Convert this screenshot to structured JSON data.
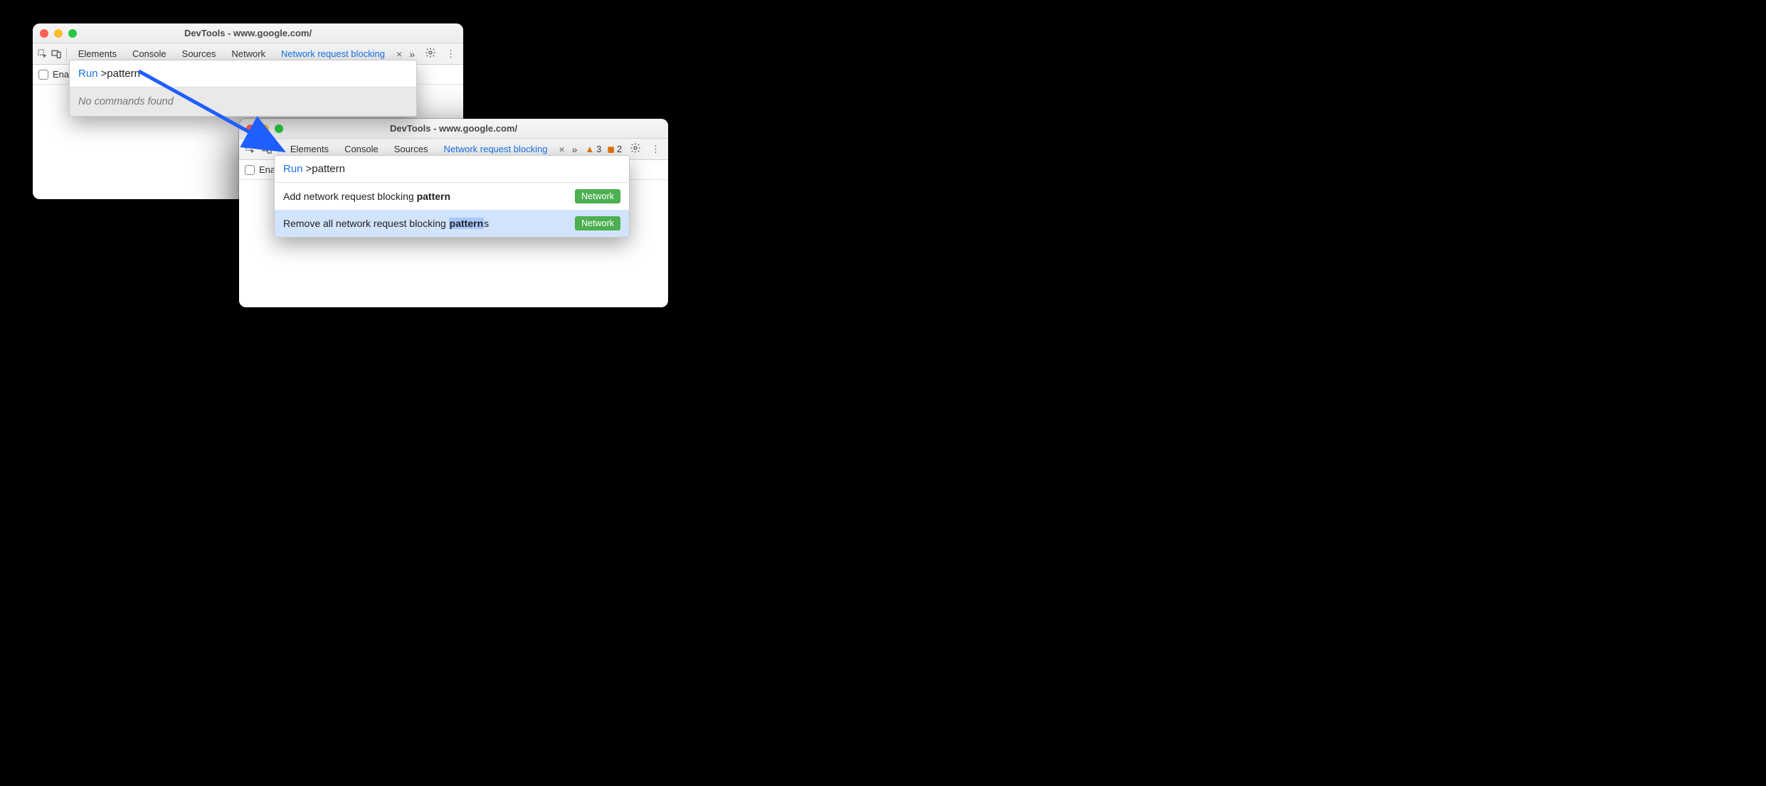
{
  "window1": {
    "title": "DevTools - www.google.com/",
    "tabs": [
      "Elements",
      "Console",
      "Sources",
      "Network",
      "Network request blocking"
    ],
    "active_tab_index": 4,
    "subbar_label": "Enab",
    "palette": {
      "prefix": "Run",
      "query": ">pattern",
      "empty_msg": "No commands found"
    }
  },
  "window2": {
    "title": "DevTools - www.google.com/",
    "tabs": [
      "Elements",
      "Console",
      "Sources",
      "Network request blocking"
    ],
    "active_tab_index": 3,
    "warn_count": "3",
    "issue_count": "2",
    "subbar_label": "Enab",
    "palette": {
      "prefix": "Run",
      "query": ">pattern",
      "rows": [
        {
          "pre": "Add network request blocking ",
          "bold": "pattern",
          "post": "",
          "cat": "Network",
          "selected": false
        },
        {
          "pre": "Remove all network request blocking ",
          "bold": "pattern",
          "post": "s",
          "cat": "Network",
          "selected": true
        }
      ]
    }
  }
}
